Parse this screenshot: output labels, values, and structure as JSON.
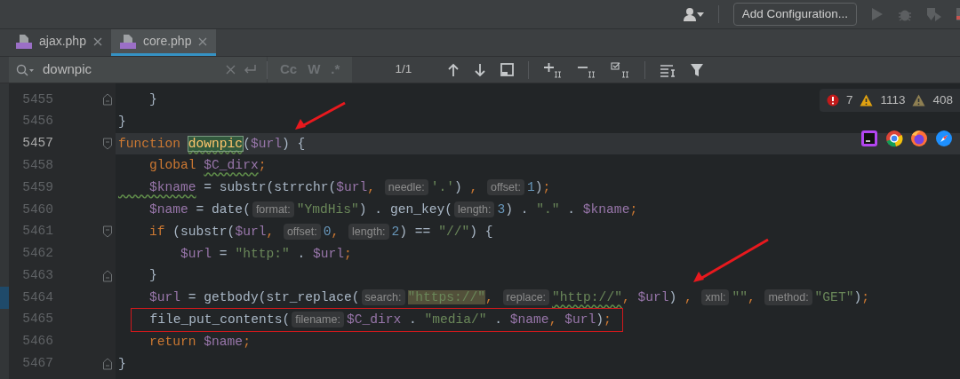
{
  "toolbar": {
    "config_button": "Add Configuration..."
  },
  "tabs": [
    {
      "label": "ajax.php",
      "selected": false
    },
    {
      "label": "core.php",
      "selected": true
    }
  ],
  "find_bar": {
    "value": "downpic",
    "options": [
      "Cc",
      "W",
      ".*"
    ],
    "match_count": "1/1"
  },
  "inspections": [
    {
      "kind": "error",
      "count": "7"
    },
    {
      "kind": "warning",
      "count": "1113"
    },
    {
      "kind": "weak",
      "count": "408"
    }
  ],
  "editor": {
    "lines": [
      {
        "number": "5455",
        "current": false,
        "changed": false,
        "boxed": false,
        "fold_start": false,
        "fold_end": true,
        "tokens": [
          {
            "kind": "plain",
            "t": "    }"
          }
        ]
      },
      {
        "number": "5456",
        "current": false,
        "changed": false,
        "boxed": false,
        "fold_start": false,
        "fold_end": false,
        "tokens": [
          {
            "kind": "plain",
            "t": "}"
          }
        ]
      },
      {
        "number": "5457",
        "current": true,
        "changed": false,
        "boxed": false,
        "fold_start": true,
        "fold_end": false,
        "tokens": [
          {
            "kind": "kw",
            "t": "function "
          },
          {
            "kind": "match",
            "t": "downpic",
            "warn": true
          },
          {
            "kind": "plain",
            "t": "("
          },
          {
            "kind": "var",
            "t": "$url"
          },
          {
            "kind": "plain",
            "t": ") {"
          }
        ]
      },
      {
        "number": "5458",
        "current": false,
        "changed": false,
        "boxed": false,
        "fold_start": false,
        "fold_end": false,
        "tokens": [
          {
            "kind": "kw",
            "t": "    global "
          },
          {
            "kind": "var",
            "t": "$C_dirx",
            "warn": true
          },
          {
            "kind": "punct",
            "t": ";"
          }
        ]
      },
      {
        "number": "5459",
        "current": false,
        "changed": false,
        "boxed": false,
        "fold_start": false,
        "fold_end": false,
        "tokens": [
          {
            "kind": "var",
            "t": "    $kname",
            "warn": true
          },
          {
            "kind": "plain",
            "t": " = substr(strrchr("
          },
          {
            "kind": "var",
            "t": "$url"
          },
          {
            "kind": "punct",
            "t": ", "
          },
          {
            "kind": "hint",
            "t": "needle:"
          },
          {
            "kind": "str",
            "t": "'.'"
          },
          {
            "kind": "plain",
            "t": ") "
          },
          {
            "kind": "punct",
            "t": ", "
          },
          {
            "kind": "hint",
            "t": "offset:"
          },
          {
            "kind": "num",
            "t": "1"
          },
          {
            "kind": "plain",
            "t": ")"
          },
          {
            "kind": "punct",
            "t": ";"
          }
        ]
      },
      {
        "number": "5460",
        "current": false,
        "changed": false,
        "boxed": false,
        "fold_start": false,
        "fold_end": false,
        "tokens": [
          {
            "kind": "var",
            "t": "    $name"
          },
          {
            "kind": "plain",
            "t": " = date("
          },
          {
            "kind": "hint",
            "t": "format:"
          },
          {
            "kind": "str",
            "t": "\"YmdHis\""
          },
          {
            "kind": "plain",
            "t": ") . gen_key("
          },
          {
            "kind": "hint",
            "t": "length:"
          },
          {
            "kind": "num",
            "t": "3"
          },
          {
            "kind": "plain",
            "t": ") . "
          },
          {
            "kind": "str",
            "t": "\".\""
          },
          {
            "kind": "plain",
            "t": " . "
          },
          {
            "kind": "var",
            "t": "$kname"
          },
          {
            "kind": "punct",
            "t": ";"
          }
        ]
      },
      {
        "number": "5461",
        "current": false,
        "changed": false,
        "boxed": false,
        "fold_start": true,
        "fold_end": false,
        "tokens": [
          {
            "kind": "kw",
            "t": "    if"
          },
          {
            "kind": "plain",
            "t": " (substr("
          },
          {
            "kind": "var",
            "t": "$url"
          },
          {
            "kind": "punct",
            "t": ", "
          },
          {
            "kind": "hint",
            "t": "offset:"
          },
          {
            "kind": "num",
            "t": "0"
          },
          {
            "kind": "punct",
            "t": ", "
          },
          {
            "kind": "hint",
            "t": "length:"
          },
          {
            "kind": "num",
            "t": "2"
          },
          {
            "kind": "plain",
            "t": ") == "
          },
          {
            "kind": "str",
            "t": "\"//\""
          },
          {
            "kind": "plain",
            "t": ") {"
          }
        ]
      },
      {
        "number": "5462",
        "current": false,
        "changed": false,
        "boxed": false,
        "fold_start": false,
        "fold_end": false,
        "tokens": [
          {
            "kind": "var",
            "t": "        $url"
          },
          {
            "kind": "plain",
            "t": " = "
          },
          {
            "kind": "str",
            "t": "\"http:\""
          },
          {
            "kind": "plain",
            "t": " . "
          },
          {
            "kind": "var",
            "t": "$url"
          },
          {
            "kind": "punct",
            "t": ";"
          }
        ]
      },
      {
        "number": "5463",
        "current": false,
        "changed": false,
        "boxed": false,
        "fold_start": false,
        "fold_end": true,
        "tokens": [
          {
            "kind": "plain",
            "t": "    }"
          }
        ]
      },
      {
        "number": "5464",
        "current": false,
        "changed": true,
        "boxed": false,
        "fold_start": false,
        "fold_end": false,
        "tokens": [
          {
            "kind": "var",
            "t": "    $url"
          },
          {
            "kind": "plain",
            "t": " = getbody(str_replace("
          },
          {
            "kind": "hint",
            "t": "search:"
          },
          {
            "kind": "strhl",
            "t": "\"https://\""
          },
          {
            "kind": "punct",
            "t": ", "
          },
          {
            "kind": "hint",
            "t": "replace:"
          },
          {
            "kind": "str",
            "t": "\"http://\"",
            "warn": true
          },
          {
            "kind": "punct",
            "t": ", "
          },
          {
            "kind": "var",
            "t": "$url"
          },
          {
            "kind": "plain",
            "t": ") "
          },
          {
            "kind": "punct",
            "t": ", "
          },
          {
            "kind": "hint",
            "t": "xml:"
          },
          {
            "kind": "str",
            "t": "\"\""
          },
          {
            "kind": "punct",
            "t": ", "
          },
          {
            "kind": "hint",
            "t": "method:"
          },
          {
            "kind": "str",
            "t": "\"GET\""
          },
          {
            "kind": "plain",
            "t": ")"
          },
          {
            "kind": "punct",
            "t": ";"
          }
        ]
      },
      {
        "number": "5465",
        "current": false,
        "changed": false,
        "boxed": true,
        "fold_start": false,
        "fold_end": false,
        "tokens": [
          {
            "kind": "plain",
            "t": "  file_put_contents("
          },
          {
            "kind": "hint",
            "t": "filename:"
          },
          {
            "kind": "var",
            "t": "$C_dirx"
          },
          {
            "kind": "plain",
            "t": " . "
          },
          {
            "kind": "str",
            "t": "\"media/\""
          },
          {
            "kind": "plain",
            "t": " . "
          },
          {
            "kind": "var",
            "t": "$name"
          },
          {
            "kind": "punct",
            "t": ", "
          },
          {
            "kind": "var",
            "t": "$url"
          },
          {
            "kind": "plain",
            "t": ")"
          },
          {
            "kind": "punct",
            "t": ";"
          }
        ]
      },
      {
        "number": "5466",
        "current": false,
        "changed": false,
        "boxed": false,
        "fold_start": false,
        "fold_end": false,
        "tokens": [
          {
            "kind": "kw",
            "t": "    return "
          },
          {
            "kind": "var",
            "t": "$name"
          },
          {
            "kind": "punct",
            "t": ";"
          }
        ]
      },
      {
        "number": "5467",
        "current": false,
        "changed": false,
        "boxed": false,
        "fold_start": false,
        "fold_end": true,
        "tokens": [
          {
            "kind": "plain",
            "t": "}"
          }
        ]
      }
    ]
  },
  "annotations": [
    {
      "kind": "arrow"
    },
    {
      "kind": "arrow"
    }
  ]
}
